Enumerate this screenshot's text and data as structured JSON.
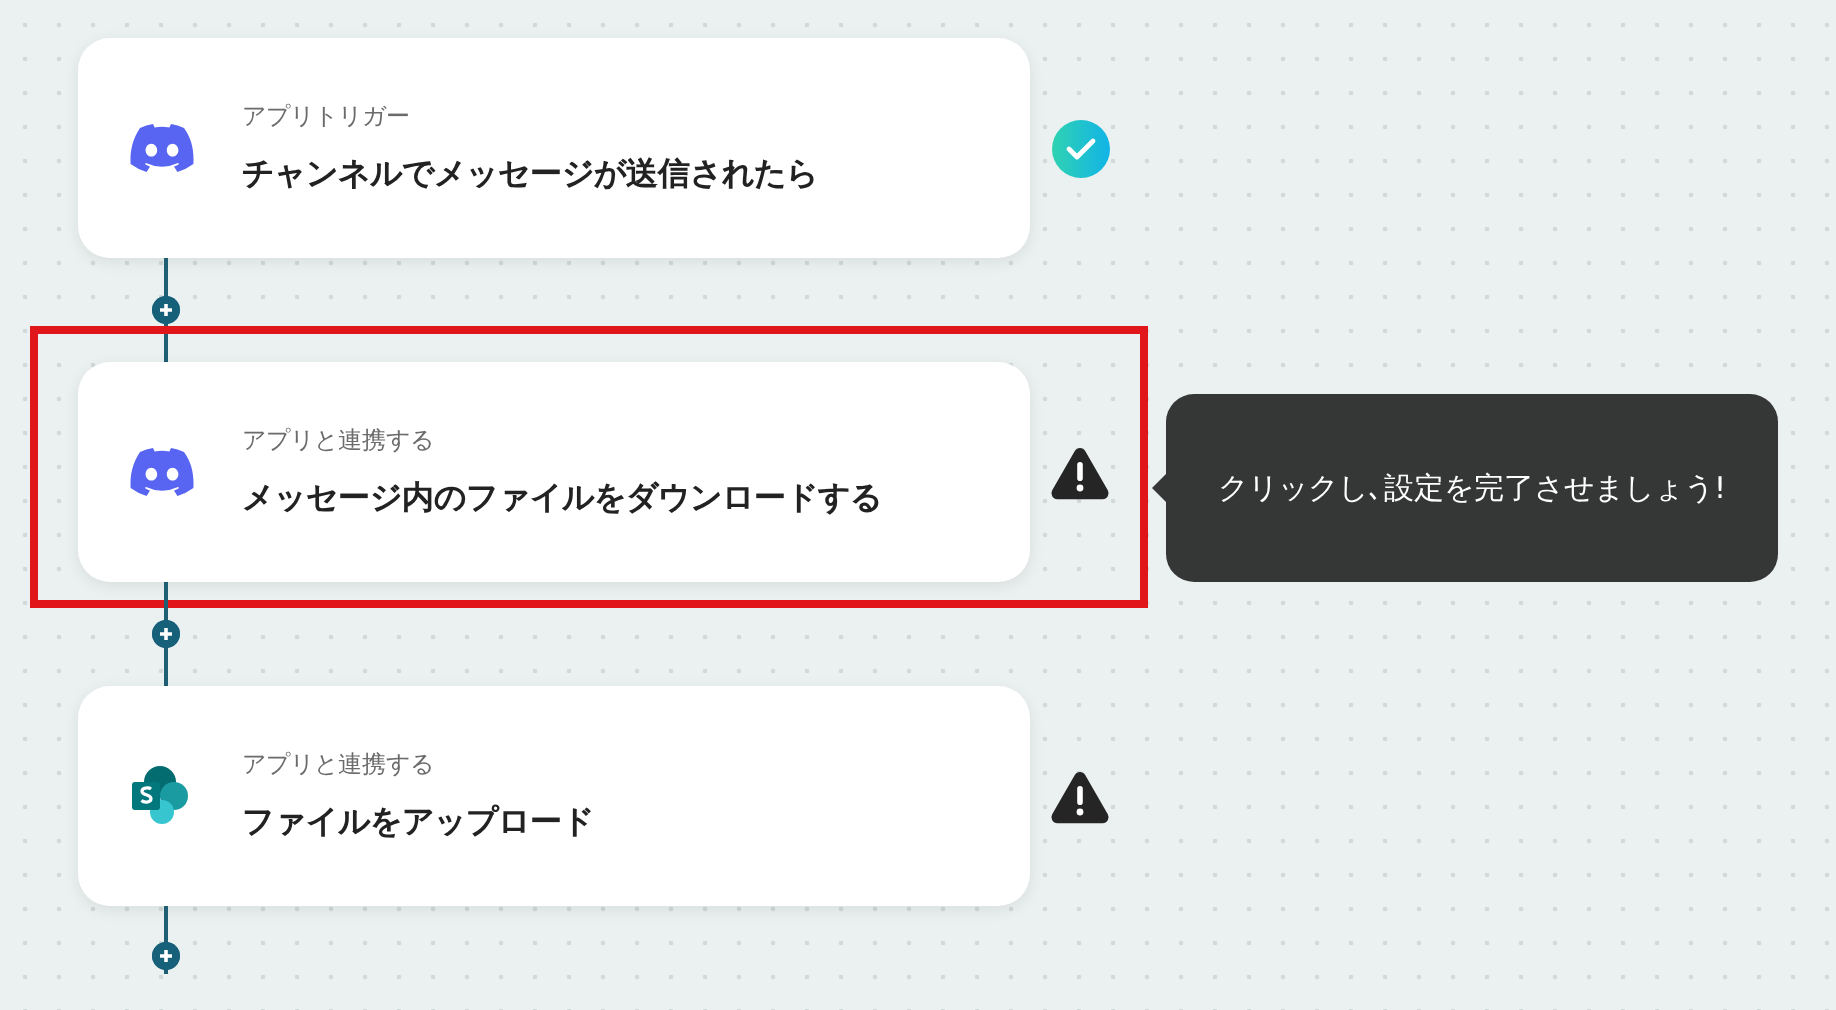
{
  "steps": [
    {
      "app": {
        "kind": "discord"
      },
      "caption": "アプリトリガー",
      "title": "チャンネルでメッセージが送信されたら",
      "status": {
        "kind": "done"
      },
      "selected": false
    },
    {
      "app": {
        "kind": "discord"
      },
      "caption": "アプリと連携する",
      "title": "メッセージ内のファイルをダウンロードする",
      "status": {
        "kind": "warning"
      },
      "selected": true,
      "tooltip": "クリックし､設定を完了させましょう!"
    },
    {
      "app": {
        "kind": "sharepoint"
      },
      "caption": "アプリと連携する",
      "title": "ファイルをアップロード",
      "status": {
        "kind": "warning"
      },
      "selected": false
    }
  ]
}
